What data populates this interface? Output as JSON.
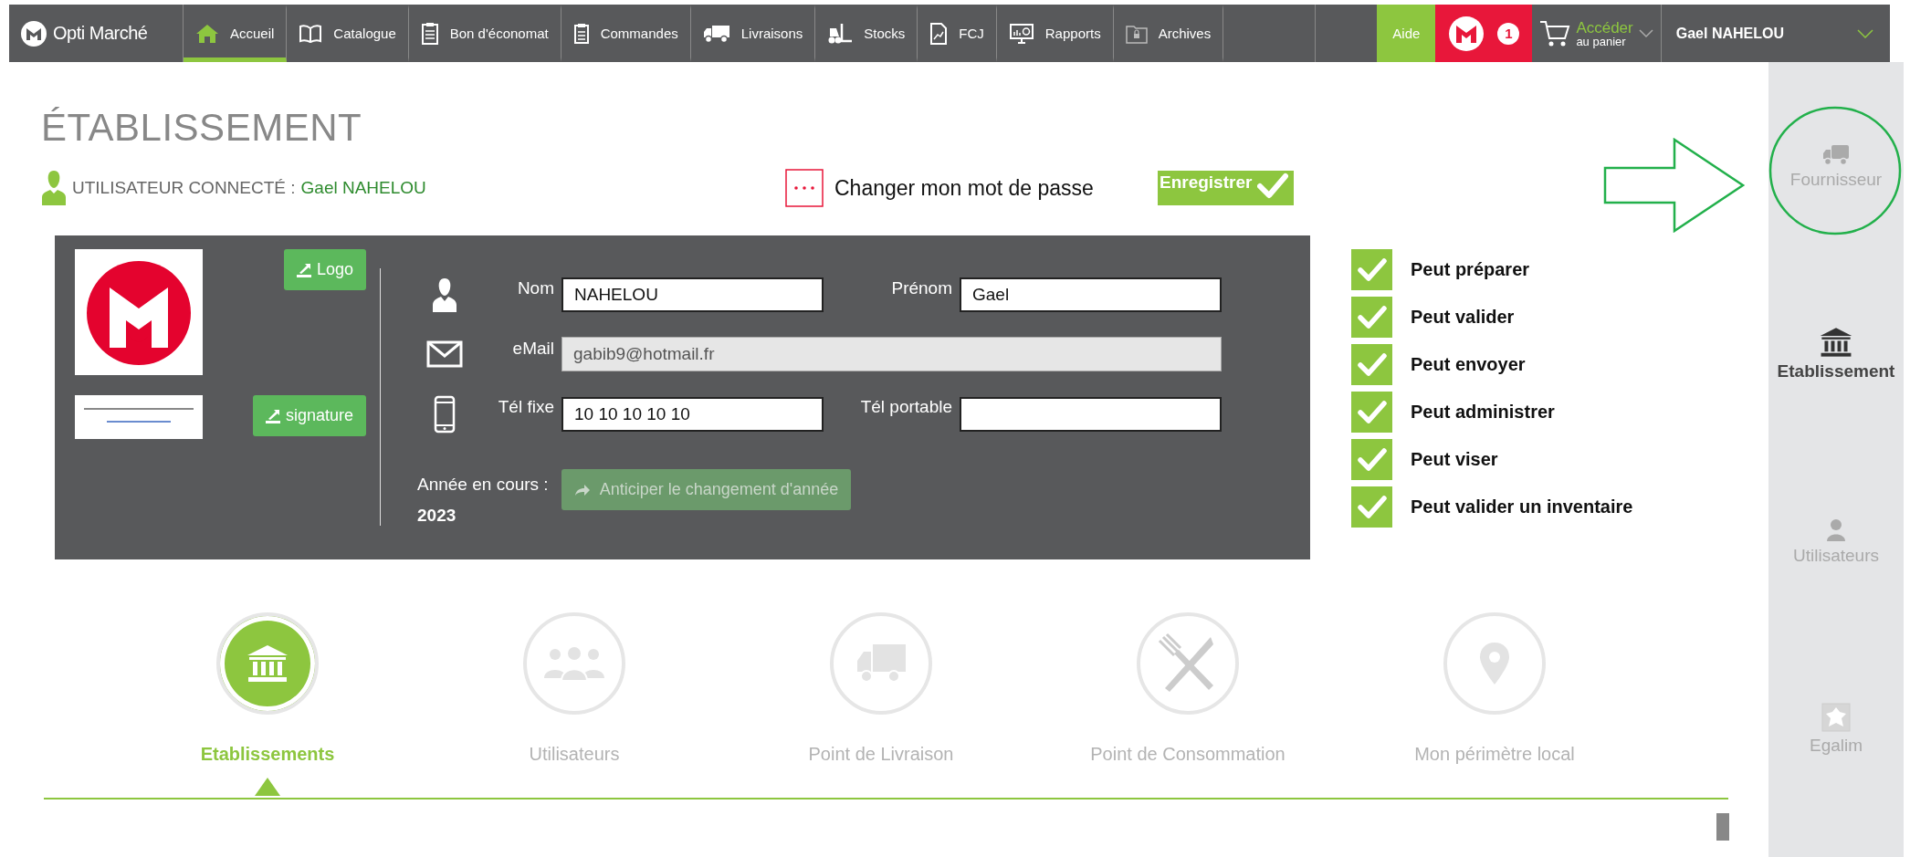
{
  "nav": {
    "brand": "Opti Marché",
    "items": [
      {
        "label": "Accueil",
        "selected": true
      },
      {
        "label": "Catalogue",
        "selected": false
      },
      {
        "label": "Bon d'économat",
        "selected": false
      },
      {
        "label": "Commandes",
        "selected": false
      },
      {
        "label": "Livraisons",
        "selected": false
      },
      {
        "label": "Stocks",
        "selected": false
      },
      {
        "label": "FCJ",
        "selected": false
      },
      {
        "label": "Rapports",
        "selected": false
      },
      {
        "label": "Archives",
        "selected": false
      }
    ],
    "help": "Aide",
    "notifications": "1",
    "cart": {
      "title": "Accéder",
      "subtitle": "au panier"
    },
    "user": "Gael NAHELOU"
  },
  "page": {
    "title": "ÉTABLISSEMENT",
    "user_label": "UTILISATEUR CONNECTÉ :",
    "user_name": "Gael NAHELOU",
    "change_password": "Changer mon mot de passe",
    "save": "Enregistrer"
  },
  "profile": {
    "logo_button": "Logo",
    "signature_button": "signature",
    "field_rows": [
      [
        {
          "label": "Nom",
          "value": "NAHELOU",
          "disabled": false
        },
        {
          "label": "Prénom",
          "value": "Gael",
          "disabled": false
        }
      ],
      [
        {
          "label": "eMail",
          "value": "gabib9@hotmail.fr",
          "disabled": true
        }
      ],
      [
        {
          "label": "Tél fixe",
          "value": "10 10 10 10 10",
          "disabled": false
        },
        {
          "label": "Tél portable",
          "disabled": false
        }
      ]
    ],
    "year_label": "Année en cours :",
    "year": "2023",
    "advance_year": "Anticiper le changement d'année"
  },
  "permissions": [
    {
      "label": "Peut préparer",
      "checked": true
    },
    {
      "label": "Peut valider",
      "checked": true
    },
    {
      "label": "Peut envoyer",
      "checked": true
    },
    {
      "label": "Peut administrer",
      "checked": true
    },
    {
      "label": "Peut viser",
      "checked": true
    },
    {
      "label": "Peut valider un inventaire",
      "checked": true
    }
  ],
  "steps": [
    {
      "label": "Etablissements",
      "selected": true
    },
    {
      "label": "Utilisateurs",
      "selected": false
    },
    {
      "label": "Point de Livraison",
      "selected": false
    },
    {
      "label": "Point de Consommation",
      "selected": false
    },
    {
      "label": "Mon périmètre local",
      "selected": false
    }
  ],
  "sidebar": [
    {
      "label": "Fournisseur",
      "selected": false
    },
    {
      "label": "Etablissement",
      "selected": true
    },
    {
      "label": "Utilisateurs",
      "selected": false
    },
    {
      "label": "Egalim",
      "selected": false
    }
  ]
}
